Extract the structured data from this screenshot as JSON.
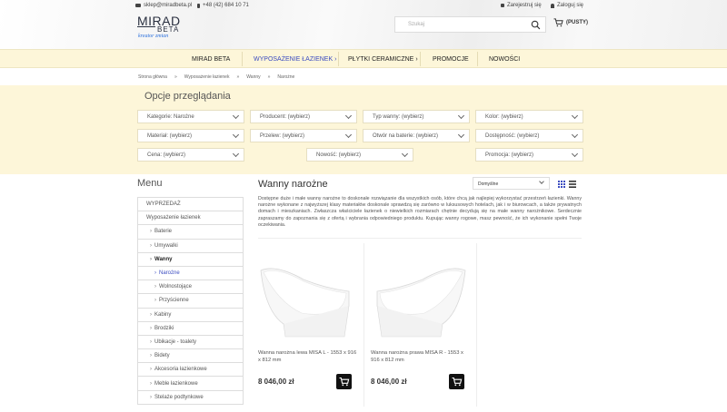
{
  "header": {
    "email": "sklep@miradbeta.pl",
    "phone": "+48 (42) 684 10 71",
    "register": "Zarejestruj się",
    "login": "Zaloguj się",
    "logo_main": "MIRAD",
    "logo_sub": "BETA",
    "logo_tagline": "kreator zmian",
    "search_placeholder": "Szukaj",
    "cart_label": "(PUSTY)"
  },
  "nav": {
    "items": [
      {
        "label": "MIRAD BETA",
        "dropdown": false,
        "active": false
      },
      {
        "label": "WYPOSAŻENIE ŁAZIENEK",
        "dropdown": true,
        "active": true
      },
      {
        "label": "PŁYTKI CERAMICZNE",
        "dropdown": true,
        "active": false
      },
      {
        "label": "PROMOCJE",
        "dropdown": false,
        "active": false
      },
      {
        "label": "NOWOŚCI",
        "dropdown": false,
        "active": false
      }
    ]
  },
  "breadcrumb": [
    "Strona główna",
    "»",
    "Wyposażenie łazienek",
    "»",
    "Wanny",
    "»",
    "Narożne"
  ],
  "filters": {
    "title": "Opcje przeglądania",
    "row1": [
      "Kategorie: Narożne",
      "Producent: (wybierz)",
      "Typ wanny: (wybierz)",
      "Kolor: (wybierz)"
    ],
    "row2": [
      "Materiał: (wybierz)",
      "Przelew: (wybierz)",
      "Otwór na baterie: (wybierz)",
      "Dostępność: (wybierz)"
    ],
    "row3": [
      "Cena: (wybierz)",
      "Nowość: (wybierz)",
      "Promocja: (wybierz)"
    ]
  },
  "sidebar": {
    "title": "Menu",
    "items": [
      {
        "label": "WYPRZEDAŻ",
        "level": 0
      },
      {
        "label": "Wyposażenie łazienek",
        "level": 0
      },
      {
        "label": "Baterie",
        "level": 1
      },
      {
        "label": "Umywalki",
        "level": 1
      },
      {
        "label": "Wanny",
        "level": 1,
        "bold": true
      },
      {
        "label": "Narożne",
        "level": 2,
        "active": true
      },
      {
        "label": "Wolnostojące",
        "level": 2
      },
      {
        "label": "Przyścienne",
        "level": 2
      },
      {
        "label": "Kabiny",
        "level": 1
      },
      {
        "label": "Brodziki",
        "level": 1
      },
      {
        "label": "Ubikacje - toalety",
        "level": 1
      },
      {
        "label": "Bidety",
        "level": 1
      },
      {
        "label": "Akcesoria łazienkowe",
        "level": 1
      },
      {
        "label": "Meble łazienkowe",
        "level": 1
      },
      {
        "label": "Stelaże podtynkowe",
        "level": 1
      }
    ]
  },
  "main": {
    "title": "Wanny narożne",
    "sort_label": "Domyślne",
    "description": "Dostępne duże i małe wanny narożne to doskonałe rozwiązanie dla wszystkich osób, które chcą jak najlepiej wykorzystać przestrzeń łazienki. Wanny narożne wykonane z najwyższej klasy materiałów doskonale sprawdzą się zarówno w luksusowych hotelach, jak i w biurowcach, a także prywatnych domach i mieszkaniach. Zwłaszcza właściciele łazienek o niewielkich rozmiarach chętnie decydują się na małe wanny narożnikowe. Serdecznie zapraszamy do zapoznania się z ofertą i wybrania odpowiedniego produktu. Kupując wanny rogowe, masz pewność, że ich wykonanie spełni Twoje oczekiwania.",
    "products": [
      {
        "name": "Wanna narożna lewa MISA L - 1553 x 916 x 812 mm",
        "price": "8 046,00 zł"
      },
      {
        "name": "Wanna narożna prawa MISA R - 1553 x 916 x 812 mm",
        "price": "8 046,00 zł"
      }
    ]
  },
  "colors": {
    "nav_bg": "#fdf6d9",
    "accent": "#3b4cc0"
  }
}
